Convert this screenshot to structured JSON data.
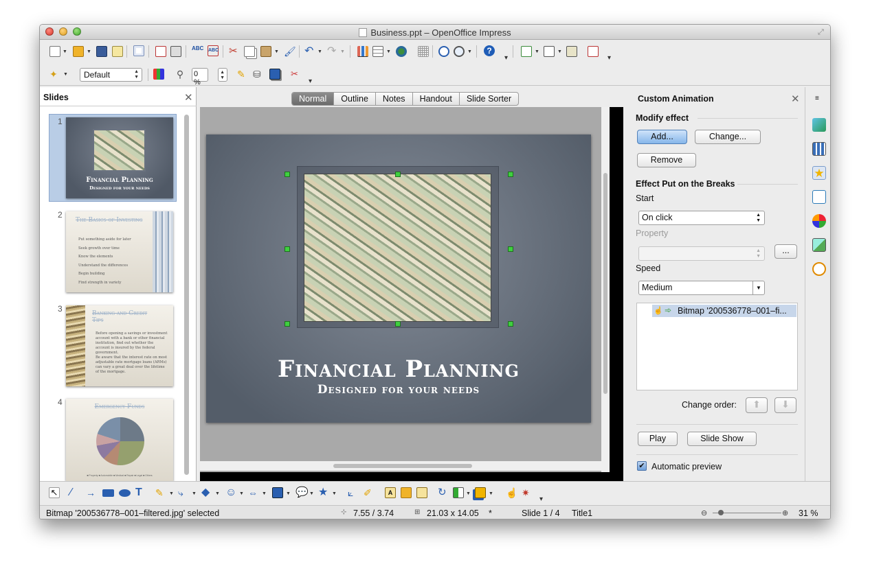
{
  "window": {
    "title": "Business.ppt – OpenOffice Impress"
  },
  "toolbar": {
    "layout_value": "Default",
    "transparency_value": "0 %"
  },
  "slides_panel": {
    "title": "Slides",
    "slides": [
      {
        "number": "1",
        "title": "Financial Planning",
        "subtitle": "Designed for your needs"
      },
      {
        "number": "2",
        "title": "The Basics of Investing",
        "bullets": [
          "Put something aside for later",
          "Seek growth over time",
          "Know the elements",
          "Understand the differences",
          "Begin building",
          "Find strength in variety"
        ]
      },
      {
        "number": "3",
        "title": "Banking and Credit Tips",
        "para1": "Before opening a savings or investment account with a bank or other financial institution, find out whether the account is insured by the federal government.",
        "para2": "Be aware that the interest rate on most adjustable rate mortgage loans (ARMs) can vary a great deal over the lifetime of the mortgage."
      },
      {
        "number": "4",
        "title": "Emergency Funds",
        "legend": "■ Property ■ Automobile ■ Medical ■ Repair ■ Legal ■ Others"
      }
    ]
  },
  "view_tabs": [
    "Normal",
    "Outline",
    "Notes",
    "Handout",
    "Slide Sorter"
  ],
  "main_slide": {
    "title": "Financial Planning",
    "subtitle": "Designed for your needs"
  },
  "animation_panel": {
    "title": "Custom Animation",
    "modify_effect": "Modify effect",
    "add_label": "Add...",
    "change_label": "Change...",
    "remove_label": "Remove",
    "effect_group": "Effect Put on the Breaks",
    "start_label": "Start",
    "start_value": "On click",
    "property_label": "Property",
    "property_btn": "...",
    "speed_label": "Speed",
    "speed_value": "Medium",
    "effect_item": "Bitmap '200536778–001–fi...",
    "change_order_label": "Change order:",
    "play_label": "Play",
    "slideshow_label": "Slide Show",
    "auto_preview_label": "Automatic preview",
    "auto_preview_checked": true
  },
  "status_bar": {
    "selection": "Bitmap '200536778–001–filtered.jpg' selected",
    "position": "7.55 / 3.74",
    "size": "21.03 x 14.05",
    "modified": "*",
    "slide": "Slide 1 / 4",
    "layout": "Title1",
    "zoom": "31 %"
  }
}
